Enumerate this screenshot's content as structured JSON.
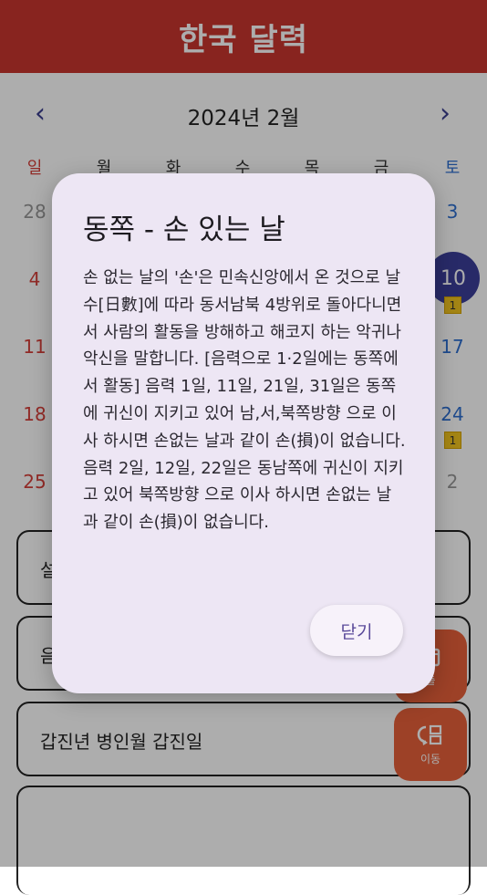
{
  "app_bar": {
    "title": "한국 달력"
  },
  "calendar": {
    "month_label": "2024년 2월",
    "prev_icon": "‹",
    "next_icon": "›",
    "weekdays": [
      "일",
      "월",
      "화",
      "수",
      "목",
      "금",
      "토"
    ],
    "visible_days": {
      "r1_sun": "28",
      "r1_sat": "3",
      "r2_sun": "4",
      "r2_sat_today": "10",
      "r3_sun": "11",
      "r3_sat": "17",
      "r4_sun": "18",
      "r4_sat": "24",
      "r5_sun": "25",
      "r5_sat": "2"
    },
    "badges": {
      "b10": "1",
      "b24": "1"
    }
  },
  "cards": [
    {
      "text": "설"
    },
    {
      "text": "음"
    },
    {
      "text": "갑진년 병인월 갑진일"
    }
  ],
  "fabs": [
    {
      "label": "출",
      "icon": "calendar-icon"
    },
    {
      "label": "이동",
      "icon": "move-icon"
    }
  ],
  "dialog": {
    "title": "동쪽 - 손 있는 날",
    "body": "손 없는 날의 '손'은 민속신앙에서 온 것으로 날수[日數]에 따라 동서남북 4방위로 돌아다니면서 사람의 활동을 방해하고 해코지 하는 악귀나 악신을 말합니다. [음력으로 1·2일에는 동쪽에서 활동] 음력 1일, 11일, 21일, 31일은 동쪽에 귀신이 지키고 있어 남,서,북쪽방향 으로 이사 하시면 손없는 날과 같이 손(損)이 없습니다. 음력 2일, 12일, 22일은 동남쪽에 귀신이 지키고 있어 북쪽방향 으로 이사 하시면 손없는 날과 같이 손(損)이 없습니다.",
    "close_label": "닫기"
  },
  "colors": {
    "brand": "#c9352f",
    "accent": "#3b3f9a",
    "fab": "#e8613a",
    "dialog_bg": "#ede6f4"
  }
}
